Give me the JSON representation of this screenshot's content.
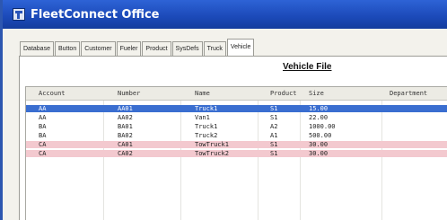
{
  "window": {
    "title": "FleetConnect Office"
  },
  "tabs": [
    "Database",
    "Button",
    "Customer",
    "Fueler",
    "Product",
    "SysDefs",
    "Truck",
    "Vehicle"
  ],
  "active_tab_index": 7,
  "heading": "Vehicle File",
  "columns": [
    "Account",
    "Number",
    "Name",
    "Product",
    "Size",
    "Department"
  ],
  "rows": [
    {
      "cells": [
        "AA",
        "AA01",
        "Truck1",
        "S1",
        "15.00",
        ""
      ],
      "state": "selected"
    },
    {
      "cells": [
        "AA",
        "AA02",
        "Van1",
        "S1",
        "22.00",
        ""
      ],
      "state": "normal"
    },
    {
      "cells": [
        "BA",
        "BA01",
        "Truck1",
        "A2",
        "1000.00",
        ""
      ],
      "state": "normal"
    },
    {
      "cells": [
        "BA",
        "BA02",
        "Truck2",
        "A1",
        "500.00",
        ""
      ],
      "state": "normal"
    },
    {
      "cells": [
        "CA",
        "CA01",
        "TowTruck1",
        "S1",
        "30.00",
        ""
      ],
      "state": "highlight"
    },
    {
      "cells": [
        "CA",
        "CA02",
        "TowTruck2",
        "S1",
        "30.00",
        ""
      ],
      "state": "highlight"
    }
  ],
  "colors": {
    "selected": "#3a6ed0",
    "highlight": "#f3c9cf",
    "titlebar": "#1b49b8"
  }
}
